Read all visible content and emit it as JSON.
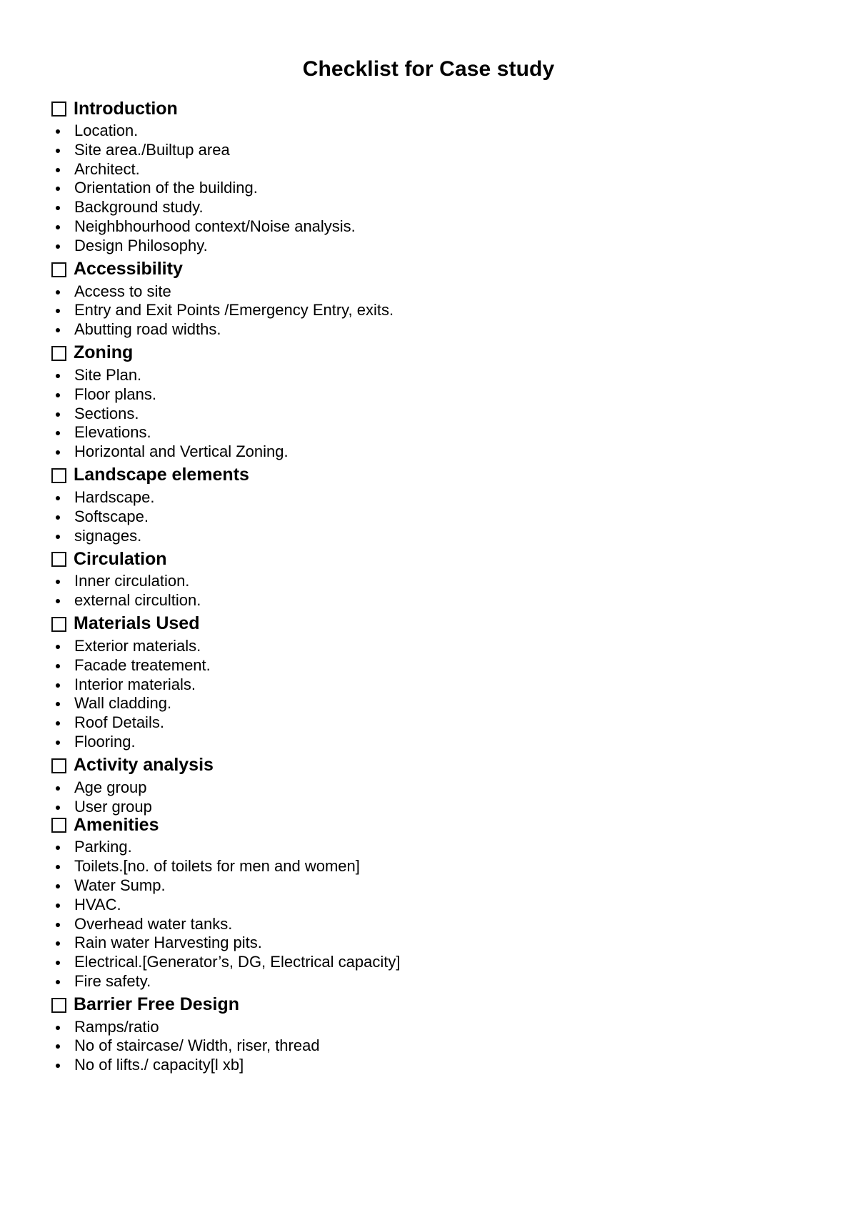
{
  "document": {
    "title": "Checklist for Case study",
    "checkbox_glyph": "empty-square",
    "text_color": "#000000",
    "background_color": "#ffffff"
  },
  "sections": [
    {
      "heading": "Introduction",
      "items": [
        "Location.",
        "Site area./Builtup area",
        "Architect.",
        "Orientation of the building.",
        "Background study.",
        "Neighbhourhood context/Noise analysis.",
        "Design Philosophy."
      ]
    },
    {
      "heading": "Accessibility",
      "items": [
        "Access to site",
        "Entry and Exit Points /Emergency Entry, exits.",
        "Abutting road widths."
      ]
    },
    {
      "heading": "Zoning",
      "items": [
        "Site Plan.",
        "Floor plans.",
        "Sections.",
        "Elevations.",
        "Horizontal and Vertical Zoning."
      ]
    },
    {
      "heading": "Landscape elements",
      "items": [
        "Hardscape.",
        "Softscape.",
        "signages."
      ]
    },
    {
      "heading": "Circulation",
      "items": [
        "Inner circulation.",
        "external circultion."
      ]
    },
    {
      "heading": "Materials Used",
      "items": [
        "Exterior materials.",
        "Facade treatement.",
        "Interior materials.",
        "Wall cladding.",
        "Roof Details.",
        "Flooring."
      ]
    },
    {
      "heading": "Activity analysis",
      "items": [
        "Age group",
        "User group"
      ]
    },
    {
      "heading": "Amenities",
      "items": [
        "Parking.",
        "Toilets.[no. of toilets for men and women]",
        "Water Sump.",
        "HVAC.",
        "Overhead water tanks.",
        "Rain water Harvesting pits.",
        "Electrical.[Generator’s, DG, Electrical capacity]",
        "Fire safety."
      ]
    },
    {
      "heading": "Barrier Free Design",
      "items": [
        "Ramps/ratio",
        "No of staircase/ Width, riser, thread",
        "No of lifts./ capacity[l xb]"
      ]
    }
  ]
}
